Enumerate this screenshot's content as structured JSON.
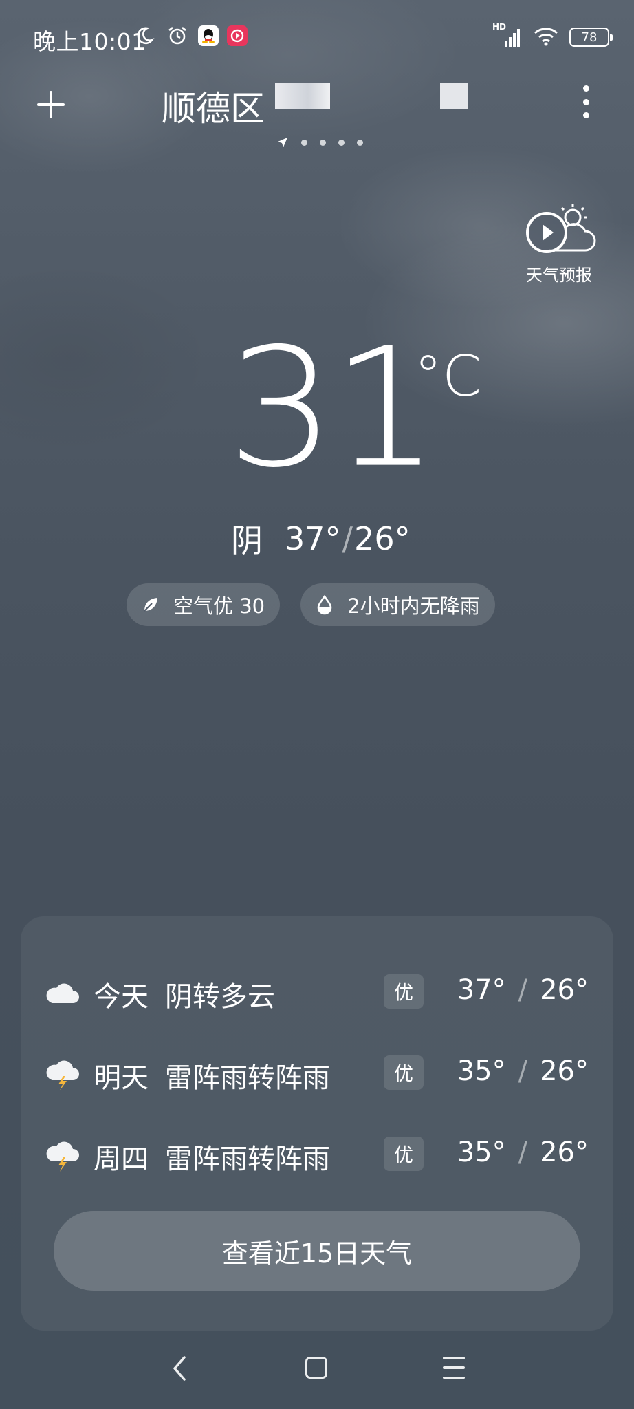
{
  "status_bar": {
    "time": "晚上10:01",
    "network_label": "HD",
    "battery": "78"
  },
  "header": {
    "location": "顺德区"
  },
  "forecast_video": {
    "label": "天气预报"
  },
  "current": {
    "temperature": "31",
    "unit": "°C",
    "condition": "阴",
    "high": "37°",
    "low": "26°",
    "range_separator": "/"
  },
  "chips": {
    "air": "空气优 30",
    "rain": "2小时内无降雨"
  },
  "forecast": [
    {
      "day": "今天",
      "condition": "阴转多云",
      "aqi": "优",
      "high": "37°",
      "low": "26°",
      "icon": "cloud-icon"
    },
    {
      "day": "明天",
      "condition": "雷阵雨转阵雨",
      "aqi": "优",
      "high": "35°",
      "low": "26°",
      "icon": "thunderstorm-icon"
    },
    {
      "day": "周四",
      "condition": "雷阵雨转阵雨",
      "aqi": "优",
      "high": "35°",
      "low": "26°",
      "icon": "thunderstorm-icon"
    }
  ],
  "temp_separator": "/",
  "more_days_button": "查看近15日天气",
  "colors": {
    "background_top": "#5a6470",
    "background_bottom": "#44505c",
    "lightning": "#f6b73c",
    "video_app": "#e8365d"
  }
}
